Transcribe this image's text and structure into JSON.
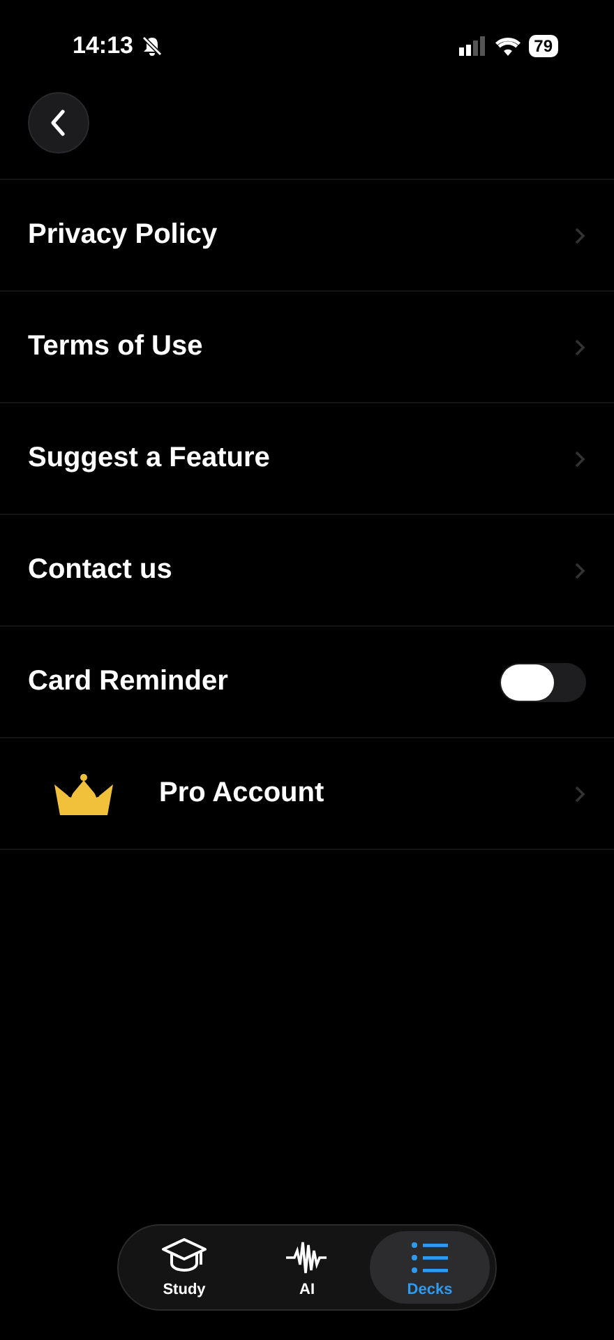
{
  "status_bar": {
    "time": "14:13",
    "battery": "79"
  },
  "settings": [
    {
      "kind": "link",
      "label": "Privacy Policy"
    },
    {
      "kind": "link",
      "label": "Terms of Use"
    },
    {
      "kind": "link",
      "label": "Suggest a Feature"
    },
    {
      "kind": "link",
      "label": "Contact us"
    },
    {
      "kind": "toggle",
      "label": "Card Reminder",
      "on": false
    },
    {
      "kind": "pro",
      "label": "Pro Account"
    }
  ],
  "tabs": [
    {
      "label": "Study",
      "kind": "cap",
      "selected": false
    },
    {
      "label": "AI",
      "kind": "wave",
      "selected": false
    },
    {
      "label": "Decks",
      "kind": "list",
      "selected": true
    }
  ]
}
